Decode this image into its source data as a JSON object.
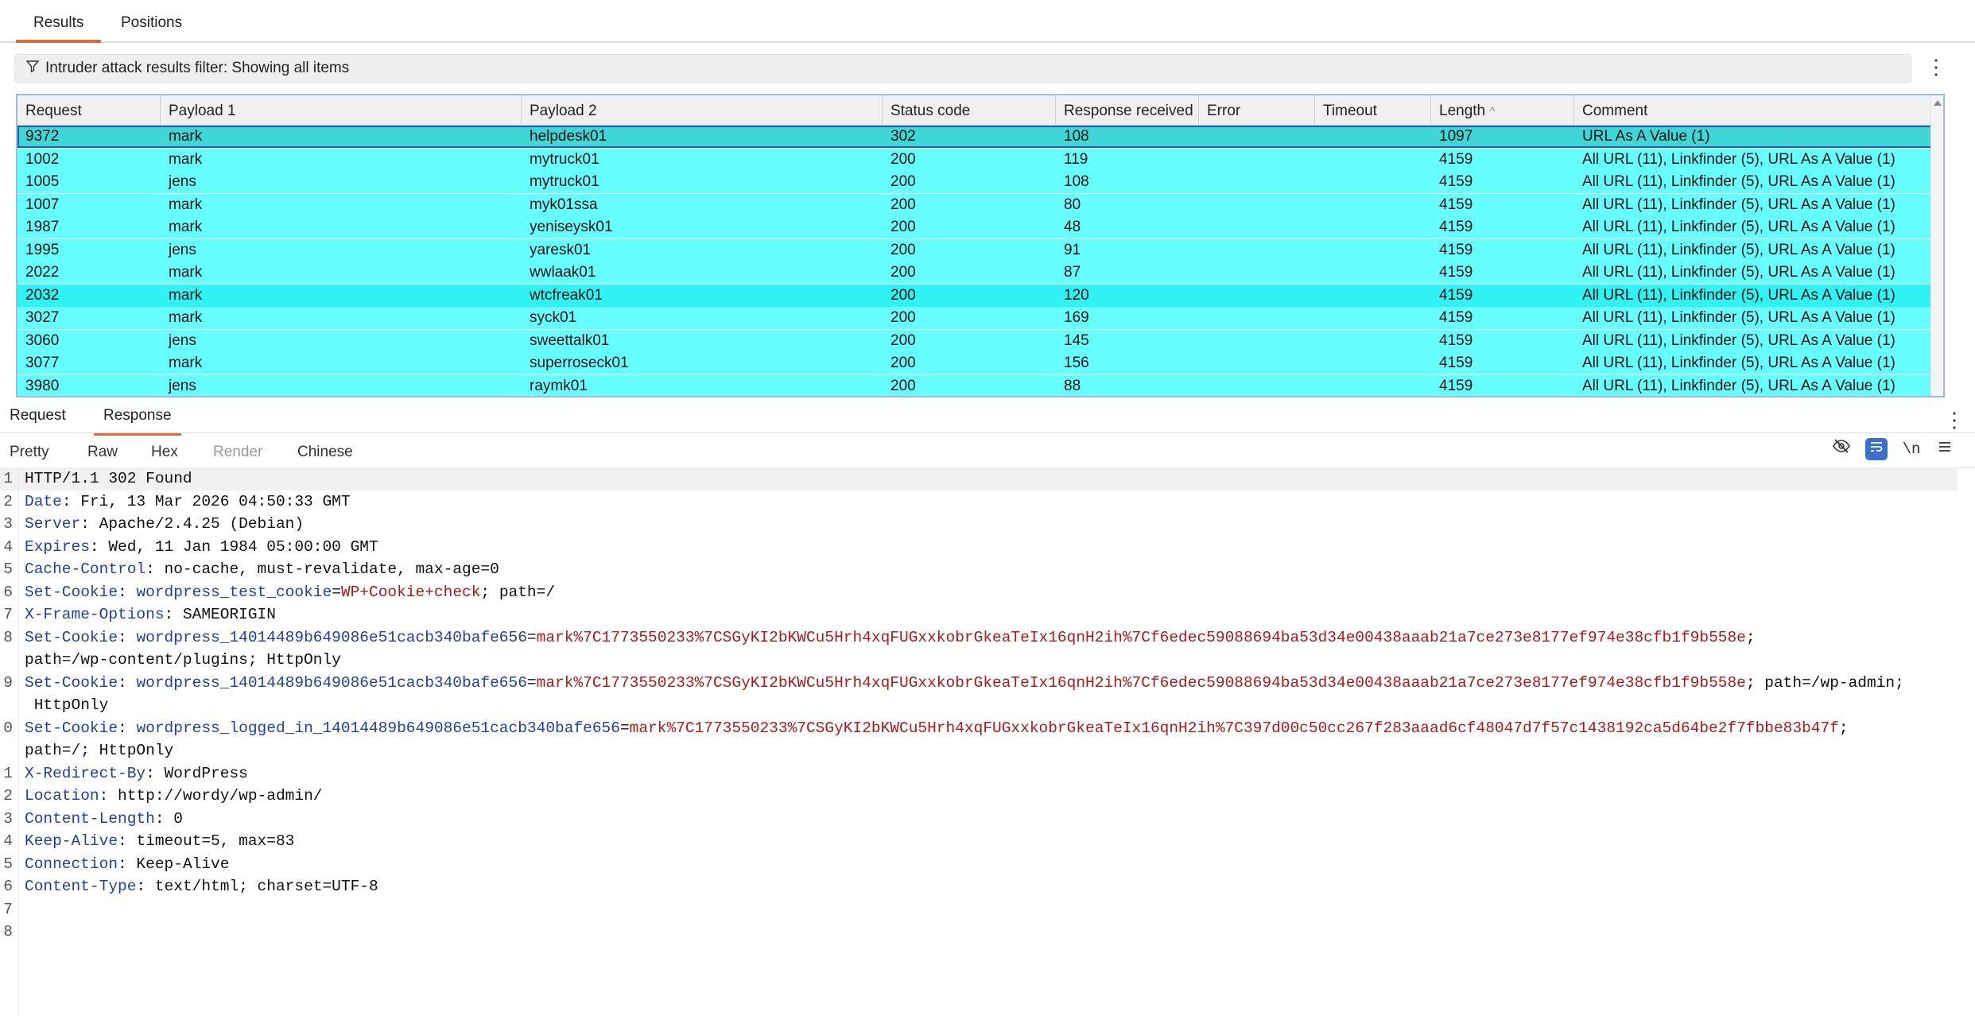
{
  "top_tabs": [
    {
      "label": "Results"
    },
    {
      "label": "Positions"
    }
  ],
  "filter": {
    "text": "Intruder attack results filter: Showing all items"
  },
  "grid": {
    "columns": [
      "Request",
      "Payload 1",
      "Payload 2",
      "Status code",
      "Response received",
      "Error",
      "Timeout",
      "Length",
      "Comment"
    ],
    "sort_indicator": "^",
    "rows": [
      [
        "9372",
        "mark",
        "helpdesk01",
        "302",
        "108",
        "",
        "",
        "1097",
        "URL As A Value (1)"
      ],
      [
        "1002",
        "mark",
        "mytruck01",
        "200",
        "119",
        "",
        "",
        "4159",
        "All URL (11), Linkfinder (5), URL As A Value (1)"
      ],
      [
        "1005",
        "jens",
        "mytruck01",
        "200",
        "108",
        "",
        "",
        "4159",
        "All URL (11), Linkfinder (5), URL As A Value (1)"
      ],
      [
        "1007",
        "mark",
        "myk01ssa",
        "200",
        "80",
        "",
        "",
        "4159",
        "All URL (11), Linkfinder (5), URL As A Value (1)"
      ],
      [
        "1987",
        "mark",
        "yeniseysk01",
        "200",
        "48",
        "",
        "",
        "4159",
        "All URL (11), Linkfinder (5), URL As A Value (1)"
      ],
      [
        "1995",
        "jens",
        "yaresk01",
        "200",
        "91",
        "",
        "",
        "4159",
        "All URL (11), Linkfinder (5), URL As A Value (1)"
      ],
      [
        "2022",
        "mark",
        "wwlaak01",
        "200",
        "87",
        "",
        "",
        "4159",
        "All URL (11), Linkfinder (5), URL As A Value (1)"
      ],
      [
        "2032",
        "mark",
        "wtcfreak01",
        "200",
        "120",
        "",
        "",
        "4159",
        "All URL (11), Linkfinder (5), URL As A Value (1)"
      ],
      [
        "3027",
        "mark",
        "syck01",
        "200",
        "169",
        "",
        "",
        "4159",
        "All URL (11), Linkfinder (5), URL As A Value (1)"
      ],
      [
        "3060",
        "jens",
        "sweettalk01",
        "200",
        "145",
        "",
        "",
        "4159",
        "All URL (11), Linkfinder (5), URL As A Value (1)"
      ],
      [
        "3077",
        "mark",
        "superroseck01",
        "200",
        "156",
        "",
        "",
        "4159",
        "All URL (11), Linkfinder (5), URL As A Value (1)"
      ],
      [
        "3980",
        "jens",
        "raymk01",
        "200",
        "88",
        "",
        "",
        "4159",
        "All URL (11), Linkfinder (5), URL As A Value (1)"
      ]
    ]
  },
  "detail_tabs": [
    {
      "label": "Request"
    },
    {
      "label": "Response"
    }
  ],
  "view_tabs": [
    {
      "label": "Pretty"
    },
    {
      "label": "Raw"
    },
    {
      "label": "Hex"
    },
    {
      "label": "Render"
    },
    {
      "label": "Chinese"
    }
  ],
  "toolbar": {
    "newline_label": "\\n"
  },
  "editor": {
    "lines": [
      {
        "n": "1",
        "parts": [
          [
            "plain",
            "HTTP/1.1 302 Found"
          ]
        ]
      },
      {
        "n": "2",
        "parts": [
          [
            "key",
            "Date"
          ],
          [
            "plain",
            ": Fri, 13 Mar 2026 04:50:33 GMT"
          ]
        ]
      },
      {
        "n": "3",
        "parts": [
          [
            "key",
            "Server"
          ],
          [
            "plain",
            ": Apache/2.4.25 (Debian)"
          ]
        ]
      },
      {
        "n": "4",
        "parts": [
          [
            "key",
            "Expires"
          ],
          [
            "plain",
            ": Wed, 11 Jan 1984 05:00:00 GMT"
          ]
        ]
      },
      {
        "n": "5",
        "parts": [
          [
            "key",
            "Cache-Control"
          ],
          [
            "plain",
            ": no-cache, must-revalidate, max-age=0"
          ]
        ]
      },
      {
        "n": "6",
        "parts": [
          [
            "key",
            "Set-Cookie"
          ],
          [
            "plain",
            ": "
          ],
          [
            "ckey",
            "wordpress_test_cookie"
          ],
          [
            "plain",
            "="
          ],
          [
            "cval",
            "WP+Cookie+check"
          ],
          [
            "plain",
            "; path=/"
          ]
        ]
      },
      {
        "n": "7",
        "parts": [
          [
            "key",
            "X-Frame-Options"
          ],
          [
            "plain",
            ": SAMEORIGIN"
          ]
        ]
      },
      {
        "n": "8",
        "parts": [
          [
            "key",
            "Set-Cookie"
          ],
          [
            "plain",
            ": "
          ],
          [
            "ckey",
            "wordpress_14014489b649086e51cacb340bafe656"
          ],
          [
            "plain",
            "="
          ],
          [
            "cval",
            "mark%7C1773550233%7CSGyKI2bKWCu5Hrh4xqFUGxxkobrGkeaTeIx16qnH2ih%7Cf6edec59088694ba53d34e00438aaab21a7ce273e8177ef974e38cfb1f9b558e"
          ],
          [
            "plain",
            ";"
          ]
        ]
      },
      {
        "n": "",
        "parts": [
          [
            "plain",
            "path=/wp-content/plugins; HttpOnly"
          ]
        ]
      },
      {
        "n": "9",
        "parts": [
          [
            "key",
            "Set-Cookie"
          ],
          [
            "plain",
            ": "
          ],
          [
            "ckey",
            "wordpress_14014489b649086e51cacb340bafe656"
          ],
          [
            "plain",
            "="
          ],
          [
            "cval",
            "mark%7C1773550233%7CSGyKI2bKWCu5Hrh4xqFUGxxkobrGkeaTeIx16qnH2ih%7Cf6edec59088694ba53d34e00438aaab21a7ce273e8177ef974e38cfb1f9b558e"
          ],
          [
            "plain",
            "; path=/wp-admin;"
          ]
        ]
      },
      {
        "n": "",
        "parts": [
          [
            "plain",
            " HttpOnly"
          ]
        ]
      },
      {
        "n": "0",
        "parts": [
          [
            "key",
            "Set-Cookie"
          ],
          [
            "plain",
            ": "
          ],
          [
            "ckey",
            "wordpress_logged_in_14014489b649086e51cacb340bafe656"
          ],
          [
            "plain",
            "="
          ],
          [
            "cval",
            "mark%7C1773550233%7CSGyKI2bKWCu5Hrh4xqFUGxxkobrGkeaTeIx16qnH2ih%7C397d00c50cc267f283aaad6cf48047d7f57c1438192ca5d64be2f7fbbe83b47f"
          ],
          [
            "plain",
            ";"
          ]
        ]
      },
      {
        "n": "",
        "parts": [
          [
            "plain",
            "path=/; HttpOnly"
          ]
        ]
      },
      {
        "n": "1",
        "parts": [
          [
            "key",
            "X-Redirect-By"
          ],
          [
            "plain",
            ": WordPress"
          ]
        ]
      },
      {
        "n": "2",
        "parts": [
          [
            "key",
            "Location"
          ],
          [
            "plain",
            ": http://wordy/wp-admin/"
          ]
        ]
      },
      {
        "n": "3",
        "parts": [
          [
            "key",
            "Content-Length"
          ],
          [
            "plain",
            ": 0"
          ]
        ]
      },
      {
        "n": "4",
        "parts": [
          [
            "key",
            "Keep-Alive"
          ],
          [
            "plain",
            ": timeout=5, max=83"
          ]
        ]
      },
      {
        "n": "5",
        "parts": [
          [
            "key",
            "Connection"
          ],
          [
            "plain",
            ": Keep-Alive"
          ]
        ]
      },
      {
        "n": "6",
        "parts": [
          [
            "key",
            "Content-Type"
          ],
          [
            "plain",
            ": text/html; charset=UTF-8"
          ]
        ]
      },
      {
        "n": "7",
        "parts": []
      },
      {
        "n": "8",
        "parts": []
      }
    ]
  },
  "colors": {
    "accent": "#e8683a",
    "row_highlight": "#66ffff",
    "selected_row": "#3fd6d6",
    "header_key": "#1f3fa8",
    "cookie_value": "#b21818"
  },
  "icons": {
    "filter": "filter-icon",
    "kebab": "kebab-menu-icon",
    "hide": "eye-slash-icon",
    "wrap": "wrap-lines-icon",
    "menu": "hamburger-menu-icon"
  }
}
